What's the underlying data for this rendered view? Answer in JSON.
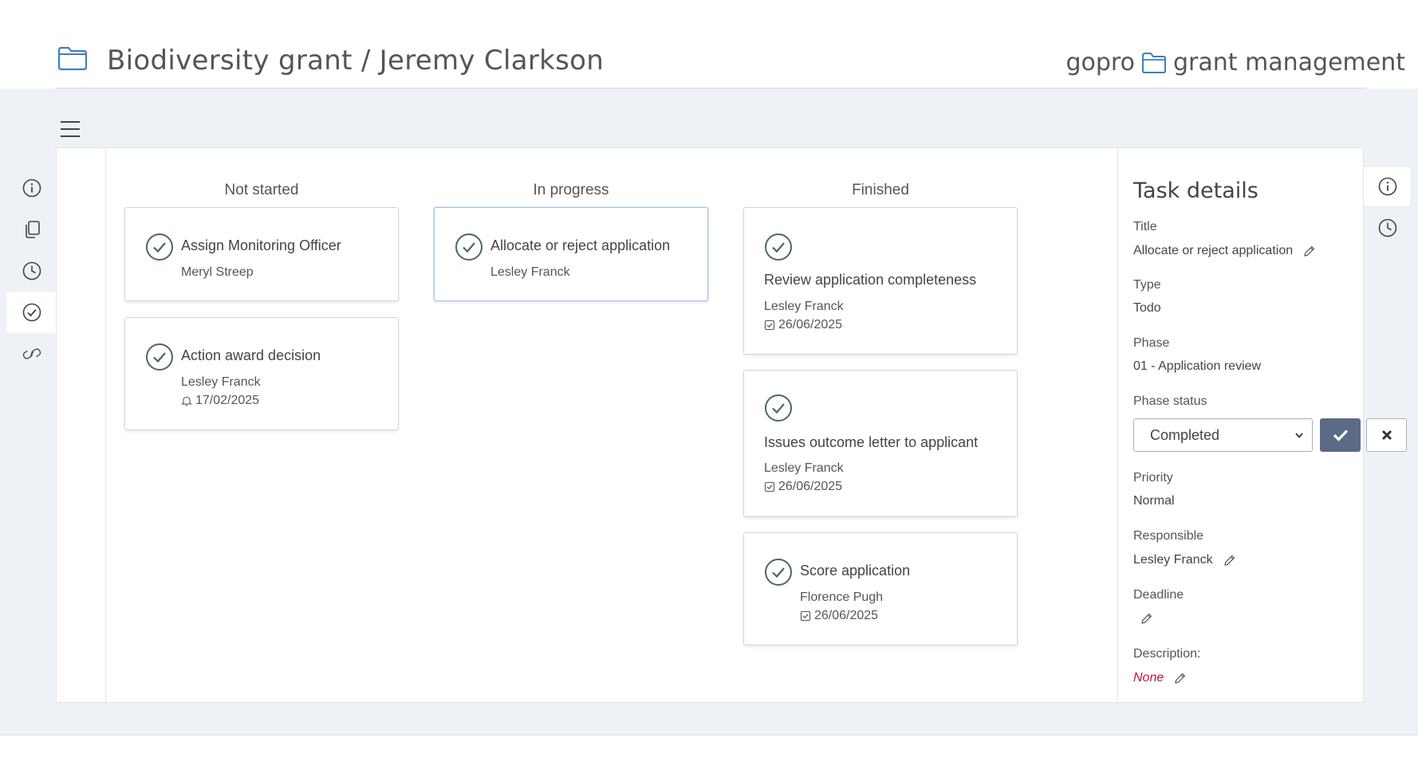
{
  "header": {
    "title": "Biodiversity grant / Jeremy Clarkson",
    "brand_left": "gopro",
    "brand_right": "grant management"
  },
  "left_rail": [
    {
      "icon": "info-icon"
    },
    {
      "icon": "copy-icon"
    },
    {
      "icon": "clock-icon"
    },
    {
      "icon": "check-circle-icon",
      "active": true
    },
    {
      "icon": "link-icon"
    }
  ],
  "right_rail": [
    {
      "icon": "info-icon",
      "active": true
    },
    {
      "icon": "clock-icon"
    }
  ],
  "board": {
    "columns": [
      {
        "title": "Not started",
        "cards": [
          {
            "title": "Assign Monitoring Officer",
            "person": "Meryl Streep"
          },
          {
            "title": "Action award decision",
            "person": "Lesley Franck",
            "date": "17/02/2025",
            "date_icon": "bell-icon"
          }
        ]
      },
      {
        "title": "In progress",
        "cards": [
          {
            "title": "Allocate or reject application",
            "person": "Lesley Franck",
            "selected": true
          }
        ]
      },
      {
        "title": "Finished",
        "cards": [
          {
            "title": "Review application completeness",
            "person": "Lesley Franck",
            "date": "26/06/2025",
            "date_icon": "checkbox-icon"
          },
          {
            "title": "Issues outcome letter to applicant",
            "person": "Lesley Franck",
            "date": "26/06/2025",
            "date_icon": "checkbox-icon"
          },
          {
            "title": "Score application",
            "person": "Florence Pugh",
            "date": "26/06/2025",
            "date_icon": "checkbox-icon"
          }
        ]
      }
    ]
  },
  "details": {
    "heading": "Task details",
    "title_label": "Title",
    "title_value": "Allocate or reject application",
    "type_label": "Type",
    "type_value": "Todo",
    "phase_label": "Phase",
    "phase_value": "01 - Application review",
    "phase_status_label": "Phase status",
    "phase_status_value": "Completed",
    "priority_label": "Priority",
    "priority_value": "Normal",
    "responsible_label": "Responsible",
    "responsible_value": "Lesley Franck",
    "deadline_label": "Deadline",
    "description_label": "Description:",
    "description_value": "None"
  },
  "colors": {
    "accent_green": "#4a6b4f",
    "folder_blue": "#3d7fc2",
    "confirm_button": "#5b6b86",
    "none_red": "#c0133f",
    "workspace_bg": "#eef1f5"
  }
}
